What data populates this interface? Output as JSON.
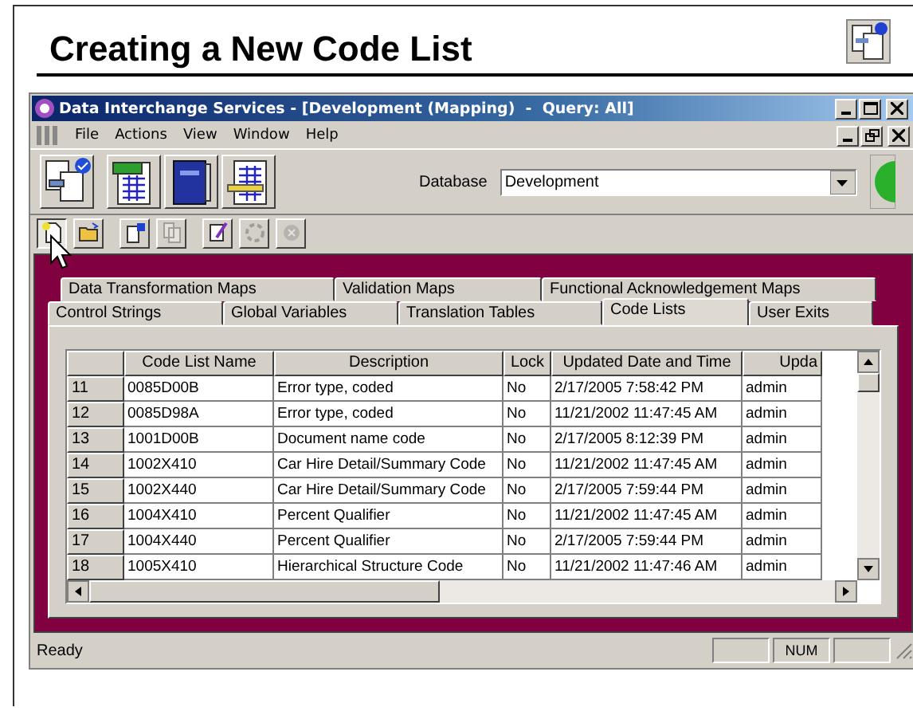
{
  "slide": {
    "title": "Creating a New Code List"
  },
  "window": {
    "title": "Data Interchange Services - [Development (Mapping)  -  Query: All]"
  },
  "menu": [
    "File",
    "Actions",
    "View",
    "Window",
    "Help"
  ],
  "database": {
    "label": "Database",
    "value": "Development"
  },
  "toolbar": [
    {
      "kind": "new",
      "disabled": false,
      "selected": true
    },
    {
      "kind": "open",
      "disabled": false,
      "selected": false
    },
    {
      "kind": "properties",
      "disabled": false,
      "selected": false
    },
    {
      "kind": "copy",
      "disabled": true,
      "selected": false
    },
    {
      "kind": "edit",
      "disabled": false,
      "selected": false
    },
    {
      "kind": "refresh",
      "disabled": true,
      "selected": false
    },
    {
      "kind": "delete",
      "disabled": true,
      "selected": false
    }
  ],
  "tabs_back": [
    {
      "label": "Data Transformation Maps",
      "selected": false
    },
    {
      "label": "Validation Maps",
      "selected": false
    },
    {
      "label": "Functional Acknowledgement Maps",
      "selected": false
    }
  ],
  "tabs_front": [
    {
      "label": "Control Strings",
      "selected": false
    },
    {
      "label": "Global Variables",
      "selected": false
    },
    {
      "label": "Translation Tables",
      "selected": false
    },
    {
      "label": "Code Lists",
      "selected": true
    },
    {
      "label": "User Exits",
      "selected": false
    }
  ],
  "table": {
    "columns": [
      "Code List Name",
      "Description",
      "Lock",
      "Updated Date and Time",
      "Upda"
    ],
    "rows": [
      {
        "num": "11",
        "cells": [
          "0085D00B",
          "Error type, coded",
          "No",
          "2/17/2005  7:58:42 PM",
          "admin"
        ]
      },
      {
        "num": "12",
        "cells": [
          "0085D98A",
          "Error type, coded",
          "No",
          "11/21/2002  11:47:45 AM",
          "admin"
        ]
      },
      {
        "num": "13",
        "cells": [
          "1001D00B",
          "Document name code",
          "No",
          "2/17/2005  8:12:39 PM",
          "admin"
        ]
      },
      {
        "num": "14",
        "cells": [
          "1002X410",
          "Car Hire Detail/Summary Code",
          "No",
          "11/21/2002  11:47:45 AM",
          "admin"
        ]
      },
      {
        "num": "15",
        "cells": [
          "1002X440",
          "Car Hire Detail/Summary Code",
          "No",
          "2/17/2005  7:59:44 PM",
          "admin"
        ]
      },
      {
        "num": "16",
        "cells": [
          "1004X410",
          "Percent Qualifier",
          "No",
          "11/21/2002  11:47:45 AM",
          "admin"
        ]
      },
      {
        "num": "17",
        "cells": [
          "1004X440",
          "Percent Qualifier",
          "No",
          "2/17/2005  7:59:44 PM",
          "admin"
        ]
      },
      {
        "num": "18",
        "cells": [
          "1005X410",
          "Hierarchical Structure Code",
          "No",
          "11/21/2002  11:47:46 AM",
          "admin"
        ]
      }
    ]
  },
  "status_bar": {
    "text": "Ready",
    "indicator": "NUM"
  }
}
